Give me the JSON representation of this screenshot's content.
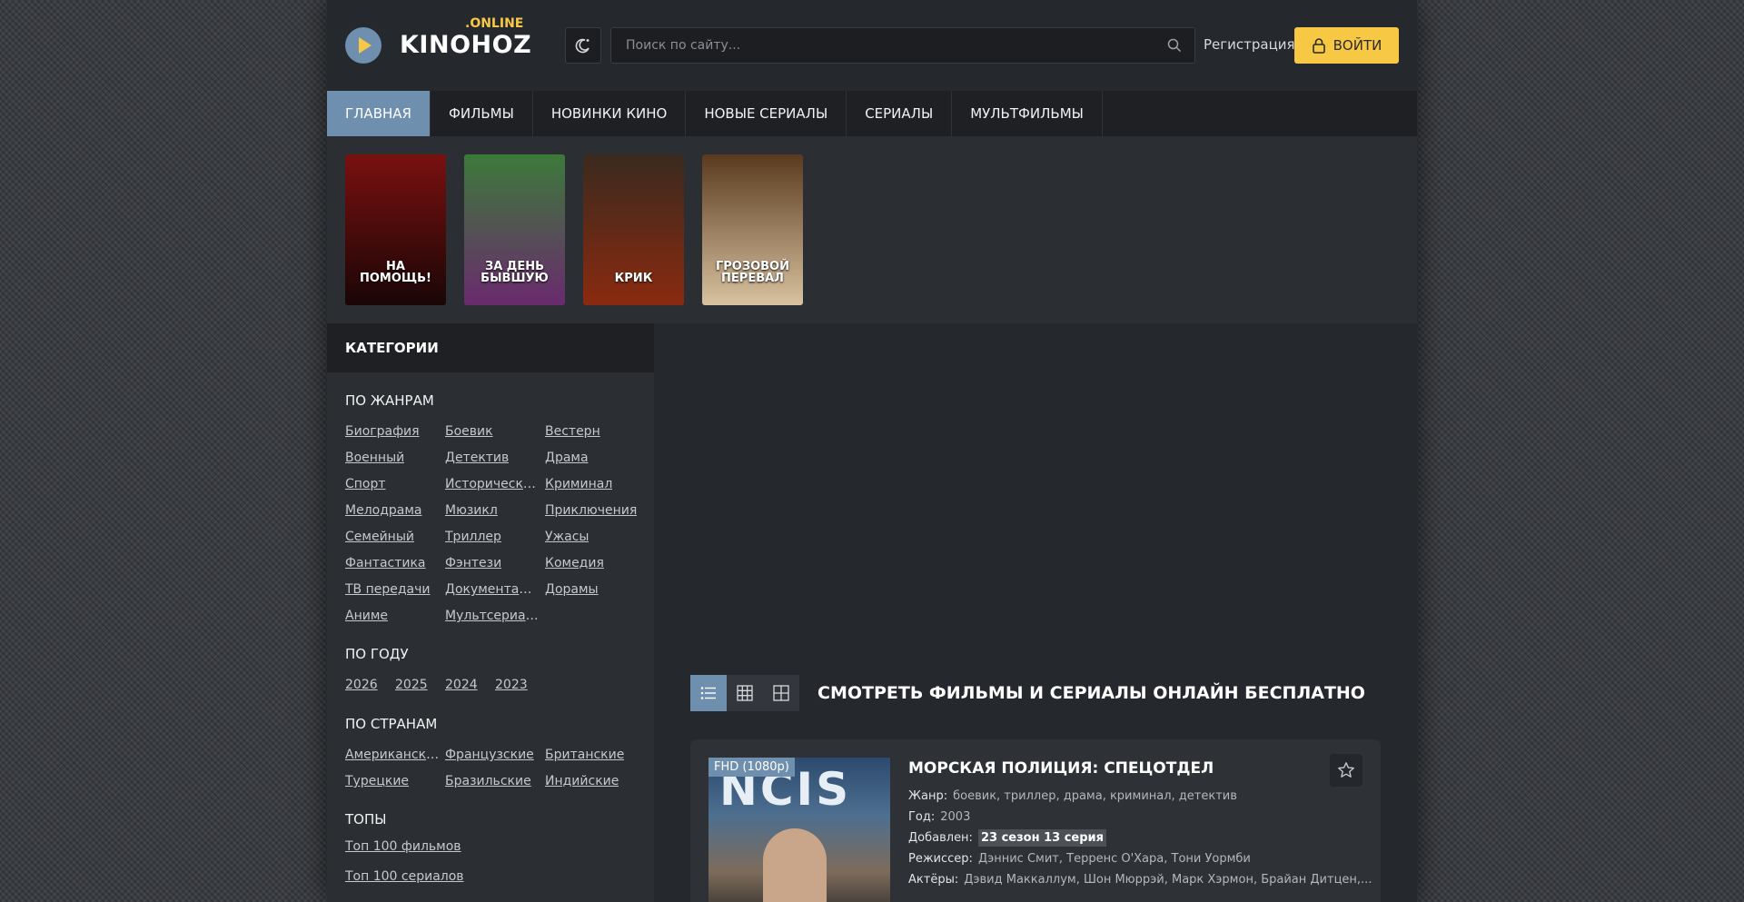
{
  "header": {
    "logo_text": "KINOHOZ",
    "logo_suffix": ".ONLINE",
    "search_placeholder": "Поиск по сайту...",
    "register_label": "Регистрация",
    "login_label": "ВОЙТИ"
  },
  "nav": {
    "items": [
      {
        "label": "ГЛАВНАЯ"
      },
      {
        "label": "ФИЛЬМЫ"
      },
      {
        "label": "НОВИНКИ КИНО"
      },
      {
        "label": "НОВЫЕ СЕРИАЛЫ"
      },
      {
        "label": "СЕРИАЛЫ"
      },
      {
        "label": "МУЛЬТФИЛЬМЫ"
      }
    ]
  },
  "carousel": {
    "posters": [
      {
        "title": "НА ПОМОЩЬ!",
        "color_top": "#7a1010",
        "color_bottom": "#1a0606"
      },
      {
        "title": "ЗА ДЕНЬ БЫВШУЮ",
        "color_top": "#3c7a3a",
        "color_bottom": "#6a2a6e"
      },
      {
        "title": "КРИК",
        "color_top": "#3a2a1e",
        "color_bottom": "#8a2a10"
      },
      {
        "title": "ГРОЗОВОЙ ПЕРЕВАЛ",
        "color_top": "#5a3a1e",
        "color_bottom": "#d8c2a0"
      }
    ]
  },
  "sidebar": {
    "heading": "КАТЕГОРИИ",
    "genres_title": "ПО ЖАНРАМ",
    "genres": [
      "Биография",
      "Боевик",
      "Вестерн",
      "Военный",
      "Детектив",
      "Драма",
      "Спорт",
      "Исторический",
      "Криминал",
      "Мелодрама",
      "Мюзикл",
      "Приключения",
      "Семейный",
      "Триллер",
      "Ужасы",
      "Фантастика",
      "Фэнтези",
      "Комедия",
      "ТВ передачи",
      "Документальный",
      "Дорамы",
      "Аниме",
      "Мультсериалы"
    ],
    "years_title": "ПО ГОДУ",
    "years": [
      "2026",
      "2025",
      "2024",
      "2023"
    ],
    "countries_title": "ПО СТРАНАМ",
    "countries": [
      "Американские",
      "Французские",
      "Британские",
      "Турецкие",
      "Бразильские",
      "Индийские"
    ],
    "tops_title": "ТОПЫ",
    "tops": [
      "Топ 100 фильмов",
      "Топ 100 сериалов"
    ]
  },
  "main": {
    "title": "СМОТРЕТЬ ФИЛЬМЫ И СЕРИАЛЫ ОНЛАЙН БЕСПЛАТНО",
    "card": {
      "quality": "FHD (1080p)",
      "poster_text": "NCIS",
      "title": "МОРСКАЯ ПОЛИЦИЯ: СПЕЦОТДЕЛ",
      "genre_label": "Жанр:",
      "genre": "боевик, триллер, драма, криминал, детектив",
      "year_label": "Год:",
      "year": "2003",
      "added_label": "Добавлен:",
      "added": "23 сезон 13 серия",
      "director_label": "Режиссер:",
      "director": "Дэннис Смит, Терренс О'Хара, Тони Уормби",
      "actors_label": "Актёры:",
      "actors": "Дэвид Маккаллум, Шон Мюррэй, Марк Хэрмон, Брайан Дитцен,..."
    }
  },
  "colors": {
    "accent": "#6e8fae",
    "button_yellow": "#f7c844",
    "background": "#25282d"
  },
  "icons": [
    "play-icon",
    "theme-moon-icon",
    "search-icon",
    "lock-icon",
    "list-view-icon",
    "grid-view-icon",
    "tile-view-icon",
    "star-icon"
  ]
}
